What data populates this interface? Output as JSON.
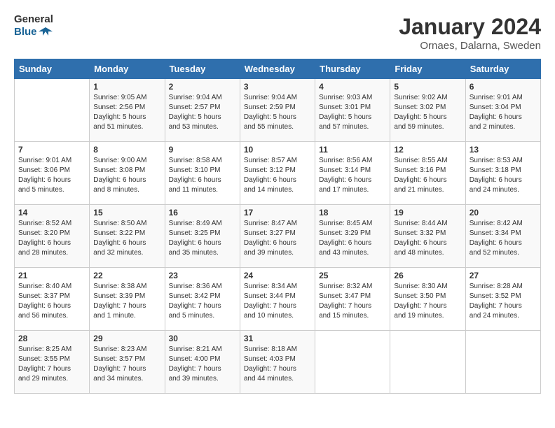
{
  "header": {
    "logo_general": "General",
    "logo_blue": "Blue",
    "month_year": "January 2024",
    "location": "Ornaes, Dalarna, Sweden"
  },
  "days_of_week": [
    "Sunday",
    "Monday",
    "Tuesday",
    "Wednesday",
    "Thursday",
    "Friday",
    "Saturday"
  ],
  "weeks": [
    [
      {
        "day": "",
        "info": ""
      },
      {
        "day": "1",
        "info": "Sunrise: 9:05 AM\nSunset: 2:56 PM\nDaylight: 5 hours\nand 51 minutes."
      },
      {
        "day": "2",
        "info": "Sunrise: 9:04 AM\nSunset: 2:57 PM\nDaylight: 5 hours\nand 53 minutes."
      },
      {
        "day": "3",
        "info": "Sunrise: 9:04 AM\nSunset: 2:59 PM\nDaylight: 5 hours\nand 55 minutes."
      },
      {
        "day": "4",
        "info": "Sunrise: 9:03 AM\nSunset: 3:01 PM\nDaylight: 5 hours\nand 57 minutes."
      },
      {
        "day": "5",
        "info": "Sunrise: 9:02 AM\nSunset: 3:02 PM\nDaylight: 5 hours\nand 59 minutes."
      },
      {
        "day": "6",
        "info": "Sunrise: 9:01 AM\nSunset: 3:04 PM\nDaylight: 6 hours\nand 2 minutes."
      }
    ],
    [
      {
        "day": "7",
        "info": "Sunrise: 9:01 AM\nSunset: 3:06 PM\nDaylight: 6 hours\nand 5 minutes."
      },
      {
        "day": "8",
        "info": "Sunrise: 9:00 AM\nSunset: 3:08 PM\nDaylight: 6 hours\nand 8 minutes."
      },
      {
        "day": "9",
        "info": "Sunrise: 8:58 AM\nSunset: 3:10 PM\nDaylight: 6 hours\nand 11 minutes."
      },
      {
        "day": "10",
        "info": "Sunrise: 8:57 AM\nSunset: 3:12 PM\nDaylight: 6 hours\nand 14 minutes."
      },
      {
        "day": "11",
        "info": "Sunrise: 8:56 AM\nSunset: 3:14 PM\nDaylight: 6 hours\nand 17 minutes."
      },
      {
        "day": "12",
        "info": "Sunrise: 8:55 AM\nSunset: 3:16 PM\nDaylight: 6 hours\nand 21 minutes."
      },
      {
        "day": "13",
        "info": "Sunrise: 8:53 AM\nSunset: 3:18 PM\nDaylight: 6 hours\nand 24 minutes."
      }
    ],
    [
      {
        "day": "14",
        "info": "Sunrise: 8:52 AM\nSunset: 3:20 PM\nDaylight: 6 hours\nand 28 minutes."
      },
      {
        "day": "15",
        "info": "Sunrise: 8:50 AM\nSunset: 3:22 PM\nDaylight: 6 hours\nand 32 minutes."
      },
      {
        "day": "16",
        "info": "Sunrise: 8:49 AM\nSunset: 3:25 PM\nDaylight: 6 hours\nand 35 minutes."
      },
      {
        "day": "17",
        "info": "Sunrise: 8:47 AM\nSunset: 3:27 PM\nDaylight: 6 hours\nand 39 minutes."
      },
      {
        "day": "18",
        "info": "Sunrise: 8:45 AM\nSunset: 3:29 PM\nDaylight: 6 hours\nand 43 minutes."
      },
      {
        "day": "19",
        "info": "Sunrise: 8:44 AM\nSunset: 3:32 PM\nDaylight: 6 hours\nand 48 minutes."
      },
      {
        "day": "20",
        "info": "Sunrise: 8:42 AM\nSunset: 3:34 PM\nDaylight: 6 hours\nand 52 minutes."
      }
    ],
    [
      {
        "day": "21",
        "info": "Sunrise: 8:40 AM\nSunset: 3:37 PM\nDaylight: 6 hours\nand 56 minutes."
      },
      {
        "day": "22",
        "info": "Sunrise: 8:38 AM\nSunset: 3:39 PM\nDaylight: 7 hours\nand 1 minute."
      },
      {
        "day": "23",
        "info": "Sunrise: 8:36 AM\nSunset: 3:42 PM\nDaylight: 7 hours\nand 5 minutes."
      },
      {
        "day": "24",
        "info": "Sunrise: 8:34 AM\nSunset: 3:44 PM\nDaylight: 7 hours\nand 10 minutes."
      },
      {
        "day": "25",
        "info": "Sunrise: 8:32 AM\nSunset: 3:47 PM\nDaylight: 7 hours\nand 15 minutes."
      },
      {
        "day": "26",
        "info": "Sunrise: 8:30 AM\nSunset: 3:50 PM\nDaylight: 7 hours\nand 19 minutes."
      },
      {
        "day": "27",
        "info": "Sunrise: 8:28 AM\nSunset: 3:52 PM\nDaylight: 7 hours\nand 24 minutes."
      }
    ],
    [
      {
        "day": "28",
        "info": "Sunrise: 8:25 AM\nSunset: 3:55 PM\nDaylight: 7 hours\nand 29 minutes."
      },
      {
        "day": "29",
        "info": "Sunrise: 8:23 AM\nSunset: 3:57 PM\nDaylight: 7 hours\nand 34 minutes."
      },
      {
        "day": "30",
        "info": "Sunrise: 8:21 AM\nSunset: 4:00 PM\nDaylight: 7 hours\nand 39 minutes."
      },
      {
        "day": "31",
        "info": "Sunrise: 8:18 AM\nSunset: 4:03 PM\nDaylight: 7 hours\nand 44 minutes."
      },
      {
        "day": "",
        "info": ""
      },
      {
        "day": "",
        "info": ""
      },
      {
        "day": "",
        "info": ""
      }
    ]
  ]
}
